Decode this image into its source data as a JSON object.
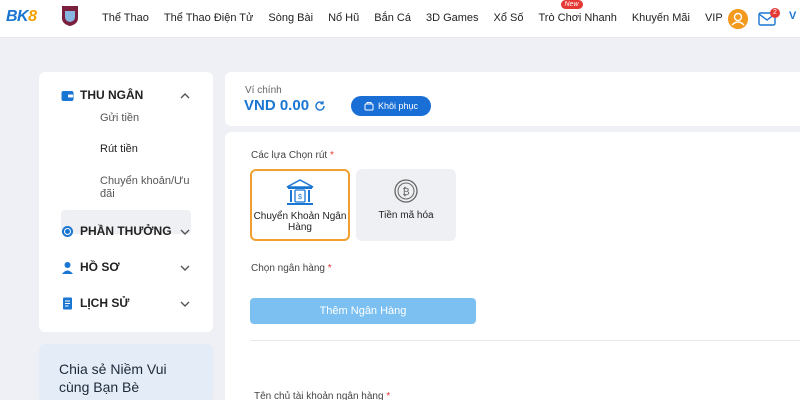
{
  "header": {
    "logo": {
      "part1": "BK",
      "part2": "8"
    },
    "nav": [
      {
        "label": "Thể Thao"
      },
      {
        "label": "Thể Thao Điện Tử"
      },
      {
        "label": "Sòng Bài"
      },
      {
        "label": "Nổ Hũ"
      },
      {
        "label": "Bắn Cá"
      },
      {
        "label": "3D Games"
      },
      {
        "label": "Xổ Số"
      },
      {
        "label": "Trò Chơi Nhanh",
        "badge": "New"
      },
      {
        "label": "Khuyến Mãi"
      },
      {
        "label": "VIP"
      }
    ],
    "mail_count": "2",
    "user_short": "V"
  },
  "sidebar": {
    "sections": [
      {
        "label": "THU NGÂN",
        "icon": "wallet-icon"
      },
      {
        "label": "PHẦN THƯỞNG",
        "icon": "coins-icon"
      },
      {
        "label": "HỒ SƠ",
        "icon": "person-icon"
      },
      {
        "label": "LỊCH SỬ",
        "icon": "document-icon"
      }
    ],
    "cashier_items": [
      "Gửi tiền",
      "Rút tiền",
      "Chuyển khoản/Ưu đãi"
    ],
    "active_item": "Rút tiền",
    "promo": "Chia sẻ Niềm Vui cùng Bạn Bè"
  },
  "wallet": {
    "label": "Ví chính",
    "value": "VND 0.00",
    "restore_label": "Khôi phục"
  },
  "withdraw": {
    "options_label": "Các lựa Chọn rút",
    "options": [
      {
        "label": "Chuyển Khoản Ngân Hàng",
        "icon": "bank-icon",
        "selected": true
      },
      {
        "label": "Tiền mã hóa",
        "icon": "bitcoin-icon",
        "selected": false
      }
    ],
    "bank_select_label": "Chọn ngân hàng",
    "add_bank_label": "Thêm Ngân Hàng",
    "holder_label": "Tên chủ tài khoản ngân hàng"
  },
  "colors": {
    "accent": "#1a6fd6",
    "highlight": "#f0a030",
    "required": "#e53935"
  }
}
